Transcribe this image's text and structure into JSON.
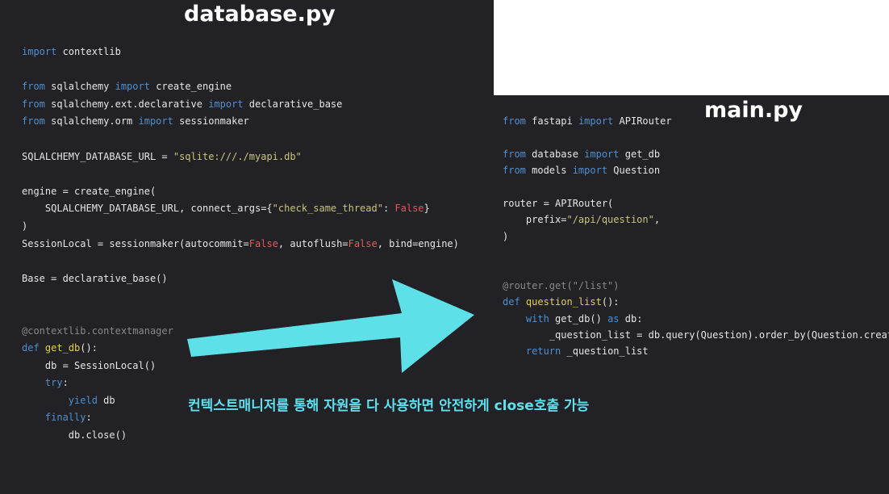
{
  "titles": {
    "left": "database.py",
    "right": "main.py"
  },
  "caption": "컨텍스트매니저를 통해 자원을 다 사용하면 안전하게 close호출 가능",
  "colors": {
    "arrow": "#5ee0e8",
    "background": "#222226",
    "keyword": "#4f8fce",
    "string": "#c8c47a",
    "false": "#e05a5a",
    "function": "#e0d04a"
  },
  "database_py": [
    [
      [
        "kw",
        "import"
      ],
      [
        "p",
        " contextlib"
      ]
    ],
    [],
    [
      [
        "kw",
        "from"
      ],
      [
        "p",
        " sqlalchemy "
      ],
      [
        "kw",
        "import"
      ],
      [
        "p",
        " create_engine"
      ]
    ],
    [
      [
        "kw",
        "from"
      ],
      [
        "p",
        " sqlalchemy.ext.declarative "
      ],
      [
        "kw",
        "import"
      ],
      [
        "p",
        " declarative_base"
      ]
    ],
    [
      [
        "kw",
        "from"
      ],
      [
        "p",
        " sqlalchemy.orm "
      ],
      [
        "kw",
        "import"
      ],
      [
        "p",
        " sessionmaker"
      ]
    ],
    [],
    [
      [
        "p",
        "SQLALCHEMY_DATABASE_URL = "
      ],
      [
        "str",
        "\"sqlite:///./myapi.db\""
      ]
    ],
    [],
    [
      [
        "p",
        "engine = create_engine("
      ]
    ],
    [
      [
        "p",
        "    SQLALCHEMY_DATABASE_URL, connect_args={"
      ],
      [
        "str",
        "\"check_same_thread\""
      ],
      [
        "p",
        ": "
      ],
      [
        "fls",
        "False"
      ],
      [
        "p",
        "}"
      ]
    ],
    [
      [
        "p",
        ")"
      ]
    ],
    [
      [
        "p",
        "SessionLocal = sessionmaker(autocommit="
      ],
      [
        "fls",
        "False"
      ],
      [
        "p",
        ", autoflush="
      ],
      [
        "fls",
        "False"
      ],
      [
        "p",
        ", bind=engine)"
      ]
    ],
    [],
    [
      [
        "p",
        "Base = declarative_base()"
      ]
    ],
    [],
    [],
    [
      [
        "dec",
        "@contextlib.contextmanager"
      ]
    ],
    [
      [
        "kw",
        "def"
      ],
      [
        "p",
        " "
      ],
      [
        "fn",
        "get_db"
      ],
      [
        "p",
        "():"
      ]
    ],
    [
      [
        "p",
        "    db = SessionLocal()"
      ]
    ],
    [
      [
        "p",
        "    "
      ],
      [
        "kw",
        "try"
      ],
      [
        "p",
        ":"
      ]
    ],
    [
      [
        "p",
        "        "
      ],
      [
        "kw",
        "yield"
      ],
      [
        "p",
        " db"
      ]
    ],
    [
      [
        "p",
        "    "
      ],
      [
        "kw",
        "finally"
      ],
      [
        "p",
        ":"
      ]
    ],
    [
      [
        "p",
        "        db.close()"
      ]
    ]
  ],
  "main_py": [
    [
      [
        "kw",
        "from"
      ],
      [
        "p",
        " fastapi "
      ],
      [
        "kw",
        "import"
      ],
      [
        "p",
        " APIRouter"
      ]
    ],
    [],
    [
      [
        "kw",
        "from"
      ],
      [
        "p",
        " database "
      ],
      [
        "kw",
        "import"
      ],
      [
        "p",
        " get_db"
      ]
    ],
    [
      [
        "kw",
        "from"
      ],
      [
        "p",
        " models "
      ],
      [
        "kw",
        "import"
      ],
      [
        "p",
        " Question"
      ]
    ],
    [],
    [
      [
        "p",
        "router = APIRouter("
      ]
    ],
    [
      [
        "p",
        "    prefix="
      ],
      [
        "str",
        "\"/api/question\""
      ],
      [
        "p",
        ","
      ]
    ],
    [
      [
        "p",
        ")"
      ]
    ],
    [],
    [],
    [
      [
        "dec",
        "@router.get(\"/list\")"
      ]
    ],
    [
      [
        "kw",
        "def"
      ],
      [
        "p",
        " "
      ],
      [
        "fn",
        "question_list"
      ],
      [
        "p",
        "():"
      ]
    ],
    [
      [
        "p",
        "    "
      ],
      [
        "kw",
        "with"
      ],
      [
        "p",
        " get_db() "
      ],
      [
        "kw",
        "as"
      ],
      [
        "p",
        " db:"
      ]
    ],
    [
      [
        "p",
        "        _question_list = db.query(Question).order_by(Question.create_d"
      ]
    ],
    [
      [
        "p",
        "    "
      ],
      [
        "kw",
        "return"
      ],
      [
        "p",
        " _question_list"
      ]
    ]
  ]
}
